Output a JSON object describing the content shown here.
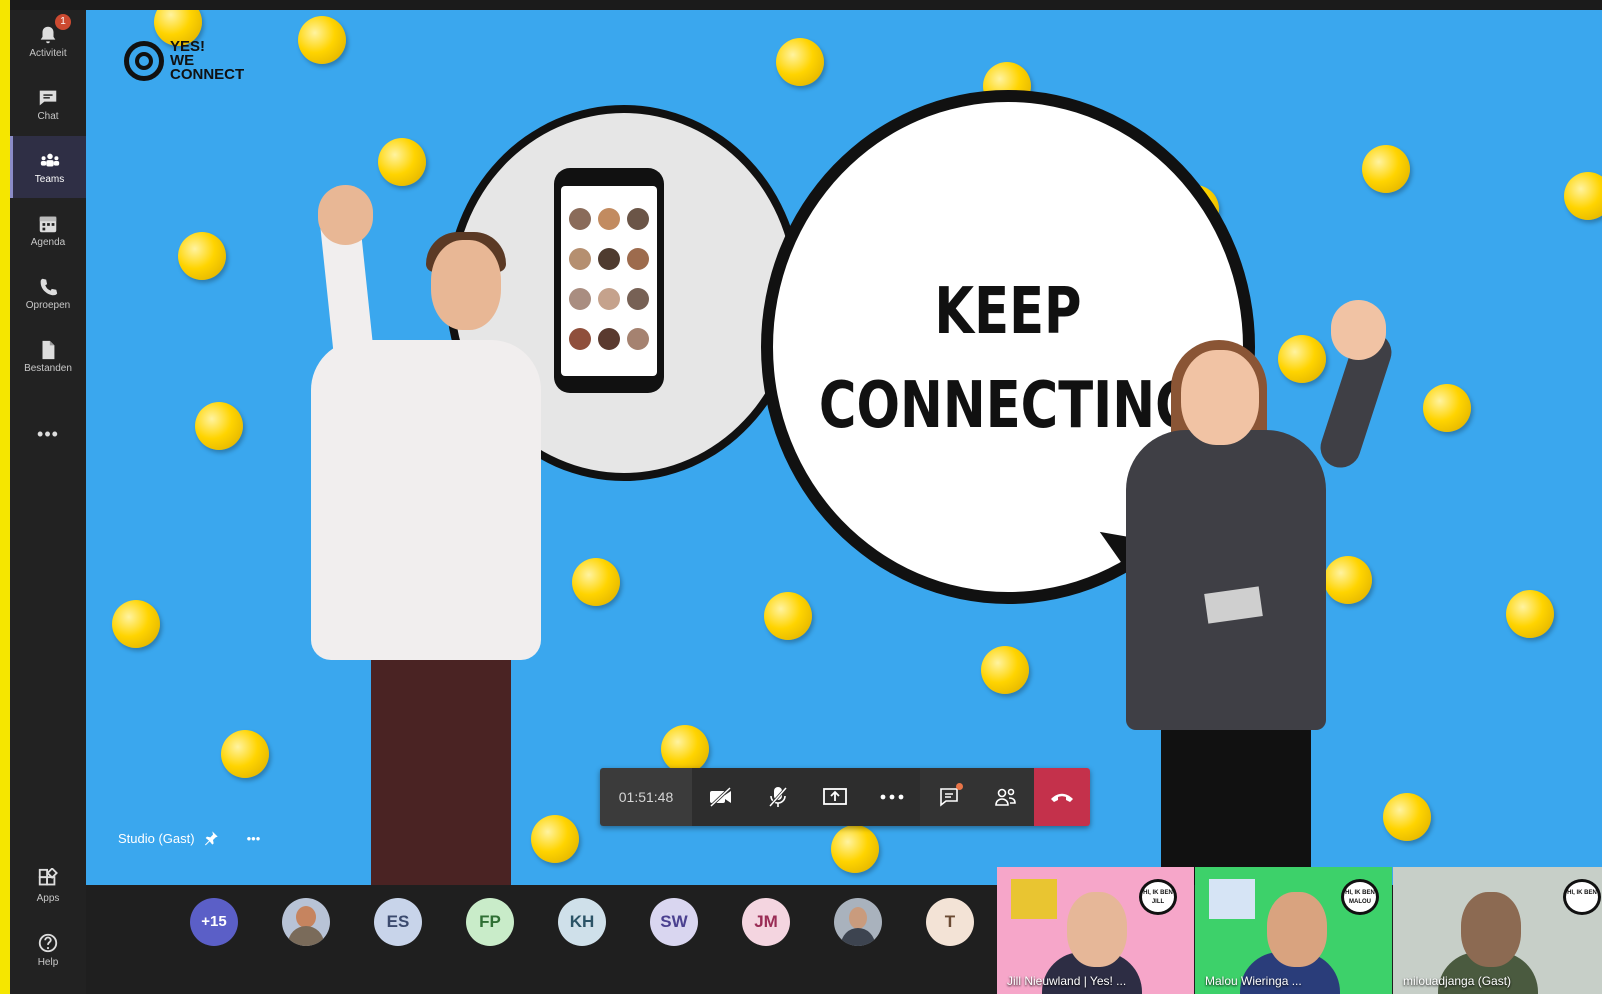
{
  "rail": {
    "activity": {
      "label": "Activiteit",
      "badge": "1",
      "icon": "bell-icon"
    },
    "chat": {
      "label": "Chat",
      "icon": "chat-icon"
    },
    "teams": {
      "label": "Teams",
      "icon": "teams-icon"
    },
    "agenda": {
      "label": "Agenda",
      "icon": "calendar-icon"
    },
    "calls": {
      "label": "Oproepen",
      "icon": "phone-icon"
    },
    "files": {
      "label": "Bestanden",
      "icon": "file-icon"
    },
    "more": "•••",
    "apps": {
      "label": "Apps",
      "icon": "apps-icon"
    },
    "help": {
      "label": "Help",
      "icon": "help-icon"
    }
  },
  "stage": {
    "logo_lines": [
      "YES!",
      "WE",
      "CONNECT"
    ],
    "headline_line1": "KEEP",
    "headline_line2": "CONNECTING",
    "participant_name": "Studio (Gast)",
    "more": "•••"
  },
  "call_controls": {
    "timer": "01:51:48",
    "icons": [
      "camera-off-icon",
      "mic-off-icon",
      "share-screen-icon",
      "more-icon",
      "chat-icon",
      "participants-icon",
      "hang-up-icon"
    ]
  },
  "participants": {
    "overflow": "+15",
    "avatars": [
      {
        "initials": "",
        "bg": "#b8c3d6"
      },
      {
        "initials": "ES",
        "bg": "#c8d4ea",
        "fg": "#3b4a6e"
      },
      {
        "initials": "FP",
        "bg": "#c9ecc9",
        "fg": "#2f6f34"
      },
      {
        "initials": "KH",
        "bg": "#cfe0ea",
        "fg": "#2b5366"
      },
      {
        "initials": "SW",
        "bg": "#d9d6f0",
        "fg": "#4b4190"
      },
      {
        "initials": "JM",
        "bg": "#f4d5e0",
        "fg": "#9a2c55"
      },
      {
        "initials": "",
        "bg": "#a9b2bd"
      },
      {
        "initials": "T",
        "bg": "#f3e3d6",
        "fg": "#6b4b34"
      }
    ],
    "videos": [
      {
        "caption": "Jill Nieuwland | Yes! ...",
        "bubble": "HI, IK BEN JILL",
        "bg": "#f6a6c9"
      },
      {
        "caption": "Malou Wieringa ...",
        "bubble": "HI, IK BEN MALOU",
        "bg": "#3dd16a"
      },
      {
        "caption": "milouadjanga (Gast)",
        "bubble": "HI, IK BEN",
        "bg": "#c7cfc8"
      }
    ]
  },
  "colors": {
    "accent": "#6264a7",
    "stage_bg": "#3aa7ee",
    "ball": "#ffd400",
    "hangup": "#c4314b",
    "border": "#f5e600"
  }
}
